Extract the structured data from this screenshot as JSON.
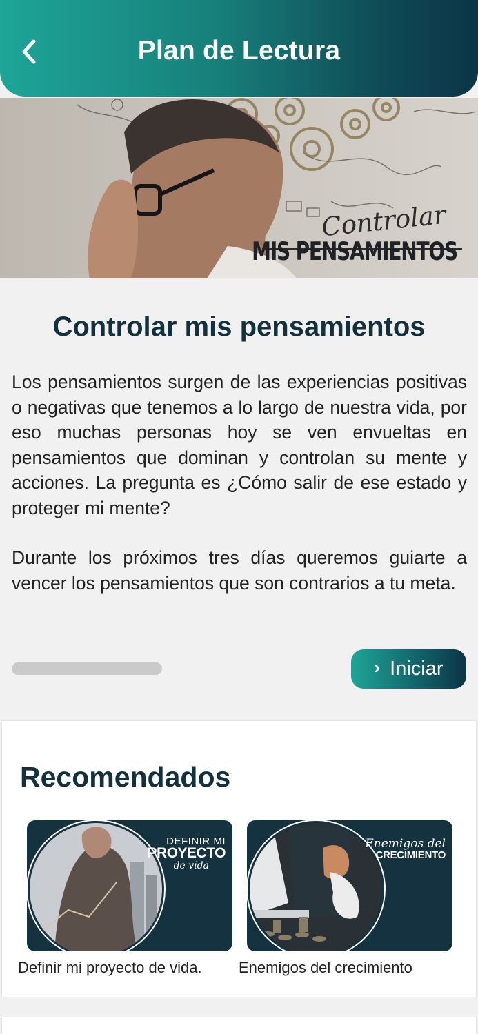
{
  "header": {
    "title": "Plan de Lectura",
    "back_icon": "chevron-left-icon"
  },
  "hero": {
    "script_text": "Controlar",
    "caps_text": "MIS PENSAMIENTOS"
  },
  "article": {
    "title": "Controlar mis pensamientos",
    "paragraph_1": "Los pensamientos surgen de las experiencias positivas o negativas que tenemos a lo largo de nuestra vida, por eso muchas personas hoy se ven envueltas en pensamientos que dominan y controlan su mente y acciones. La pregunta es ¿Cómo salir de ese estado y proteger mi mente?",
    "paragraph_2": "Durante los próximos tres días queremos guiarte a vencer los pensamientos que son contrarios a tu meta.",
    "progress": 0,
    "start_label": "Iniciar",
    "start_icon": "chevron-right-icon"
  },
  "recommended": {
    "title": "Recomendados",
    "items": [
      {
        "label": "Definir mi proyecto de vida.",
        "thumb_line1": "DEFINIR MI",
        "thumb_line2": "PROYECTO",
        "thumb_line3": "de vida"
      },
      {
        "label": "Enemigos del crecimiento",
        "thumb_line1": "Enemigos del",
        "thumb_line2": "CRECIMIENTO"
      }
    ]
  },
  "colors": {
    "accent_start": "#1ea597",
    "accent_end": "#0c3446",
    "title_text": "#13303d",
    "background": "#f1f1f1"
  }
}
